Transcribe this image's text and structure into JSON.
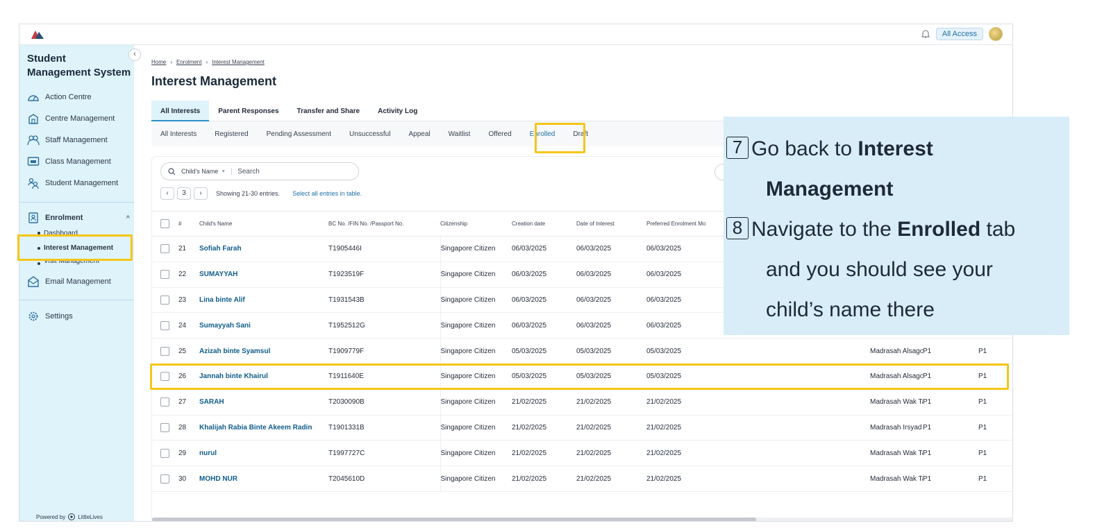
{
  "topbar": {
    "access_label": "All Access"
  },
  "sidebar": {
    "title": "Student Management System",
    "items": [
      {
        "label": "Action Centre",
        "icon": "gauge-icon"
      },
      {
        "label": "Centre Management",
        "icon": "building-icon"
      },
      {
        "label": "Staff Management",
        "icon": "staff-icon"
      },
      {
        "label": "Class Management",
        "icon": "class-icon"
      },
      {
        "label": "Student Management",
        "icon": "students-icon"
      }
    ],
    "enrolment": {
      "label": "Enrolment",
      "subitems": [
        "Dashboard",
        "Interest Management",
        "Visit Management"
      ]
    },
    "email_label": "Email Management",
    "settings_label": "Settings",
    "powered_by": "Powered by",
    "powered_brand": "LittleLives"
  },
  "breadcrumb": {
    "home": "Home",
    "enrolment": "Enrolment",
    "current": "Interest Management"
  },
  "page_title": "Interest Management",
  "tabs": [
    "All Interests",
    "Parent Responses",
    "Transfer and Share",
    "Activity Log"
  ],
  "subtabs": [
    "All Interests",
    "Registered",
    "Pending Assessment",
    "Unsuccessful",
    "Appeal",
    "Waitlist",
    "Offered",
    "Enrolled",
    "Draft"
  ],
  "search": {
    "field_label": "Child's Name",
    "placeholder": "Search"
  },
  "pager": {
    "page": "3",
    "showing": "Showing 21-30 entries.",
    "select_all": "Select all entries in table."
  },
  "table": {
    "headers": [
      "#",
      "Child's Name",
      "BC No. /FIN No. /Passport No.",
      "Citizenship",
      "Creation date",
      "Date of Interest",
      "Preferred Enrolment Mo",
      "",
      "",
      ""
    ],
    "rows": [
      {
        "num": "21",
        "name": "Sofiah Farah",
        "id": "T1905446I",
        "citizenship": "Singapore Citizen",
        "creation": "06/03/2025",
        "interest": "06/03/2025",
        "preferred": "06/03/2025",
        "centre": "",
        "level1": "",
        "level2": ""
      },
      {
        "num": "22",
        "name": "SUMAYYAH",
        "id": "T1923519F",
        "citizenship": "Singapore Citizen",
        "creation": "06/03/2025",
        "interest": "06/03/2025",
        "preferred": "06/03/2025",
        "centre": "",
        "level1": "",
        "level2": ""
      },
      {
        "num": "23",
        "name": "Lina binte Alif",
        "id": "T1931543B",
        "citizenship": "Singapore Citizen",
        "creation": "06/03/2025",
        "interest": "06/03/2025",
        "preferred": "06/03/2025",
        "centre": "",
        "level1": "",
        "level2": ""
      },
      {
        "num": "24",
        "name": "Sumayyah Sani",
        "id": "T1952512G",
        "citizenship": "Singapore Citizen",
        "creation": "06/03/2025",
        "interest": "06/03/2025",
        "preferred": "06/03/2025",
        "centre": "",
        "level1": "",
        "level2": ""
      },
      {
        "num": "25",
        "name": "Azizah binte Syamsul",
        "id": "T1909779F",
        "citizenship": "Singapore Citizen",
        "creation": "05/03/2025",
        "interest": "05/03/2025",
        "preferred": "05/03/2025",
        "centre": "Madrasah Alsagoff Al-Arabiah",
        "level1": "P1",
        "level2": "P1"
      },
      {
        "num": "26",
        "name": "Jannah binte Khairul",
        "id": "T1911640E",
        "citizenship": "Singapore Citizen",
        "creation": "05/03/2025",
        "interest": "05/03/2025",
        "preferred": "05/03/2025",
        "centre": "Madrasah Alsagoff Al-Arabiah",
        "level1": "P1",
        "level2": "P1"
      },
      {
        "num": "27",
        "name": "SARAH",
        "id": "T2030090B",
        "citizenship": "Singapore Citizen",
        "creation": "21/02/2025",
        "interest": "21/02/2025",
        "preferred": "21/02/2025",
        "centre": "Madrasah Wak Tanjong Al-Islamiah",
        "level1": "P1",
        "level2": "P1"
      },
      {
        "num": "28",
        "name": "Khalijah Rabia Binte Akeem Radin",
        "id": "T1901331B",
        "citizenship": "Singapore Citizen",
        "creation": "21/02/2025",
        "interest": "21/02/2025",
        "preferred": "21/02/2025",
        "centre": "Madrasah Irsyad Zuhri Al-Islamiah",
        "level1": "P1",
        "level2": "P1"
      },
      {
        "num": "29",
        "name": "nurul",
        "id": "T1997727C",
        "citizenship": "Singapore Citizen",
        "creation": "21/02/2025",
        "interest": "21/02/2025",
        "preferred": "21/02/2025",
        "centre": "Madrasah Wak Tanjong Al-Islamiah",
        "level1": "P1",
        "level2": "P1"
      },
      {
        "num": "30",
        "name": "MOHD NUR",
        "id": "T2045610D",
        "citizenship": "Singapore Citizen",
        "creation": "21/02/2025",
        "interest": "21/02/2025",
        "preferred": "21/02/2025",
        "centre": "Madrasah Wak Tanjong Al-Islamiah",
        "level1": "P1",
        "level2": "P1"
      }
    ]
  },
  "callout": {
    "step7_num": "7",
    "step7_text": "Go back to ",
    "step7_bold": "Interest",
    "step7_bold2": "Management",
    "step8_num": "8",
    "step8_text": "Navigate to the ",
    "step8_bold": "Enrolled",
    "step8_tail": " tab",
    "step8_line2": "and you should see your",
    "step8_line3": "child’s name there"
  },
  "colors": {
    "highlight": "#f5c518",
    "sidebar_bg": "#dff3fb",
    "link": "#0f5c8a",
    "callout_bg": "#d8edf8"
  }
}
